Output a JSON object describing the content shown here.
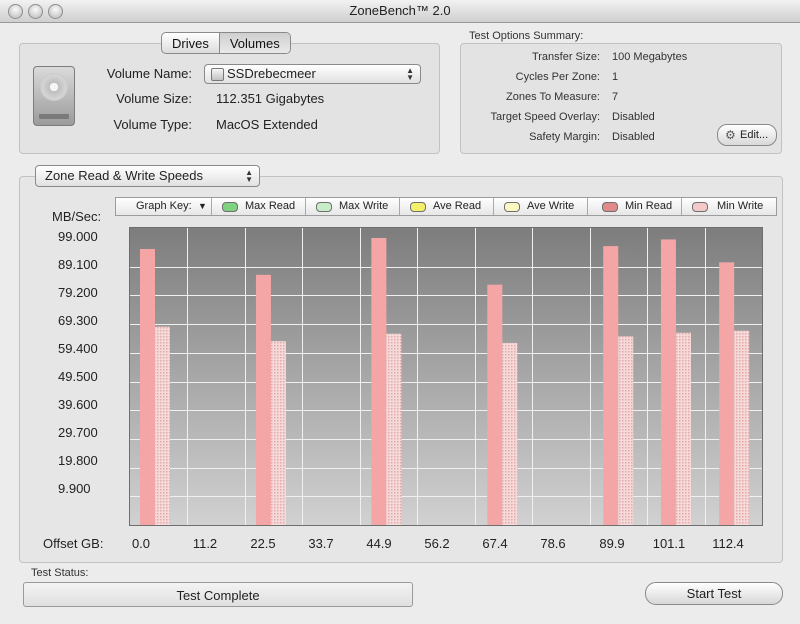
{
  "window": {
    "title": "ZoneBench™ 2.0"
  },
  "tabs": [
    {
      "label": "Drives"
    },
    {
      "label": "Volumes",
      "selected": true
    }
  ],
  "volume": {
    "name_label": "Volume Name:",
    "name_value": "SSDrebecmeer",
    "size_label": "Volume Size:",
    "size_value": "112.351 Gigabytes",
    "type_label": "Volume Type:",
    "type_value": "MacOS Extended",
    "icon": "hard-drive-icon"
  },
  "options": {
    "heading": "Test Options Summary:",
    "rows": [
      {
        "label": "Transfer Size:",
        "value": "100 Megabytes"
      },
      {
        "label": "Cycles Per Zone:",
        "value": "1"
      },
      {
        "label": "Zones To Measure:",
        "value": "7"
      },
      {
        "label": "Target Speed Overlay:",
        "value": "Disabled"
      },
      {
        "label": "Safety Margin:",
        "value": "Disabled"
      }
    ],
    "edit_label": "Edit..."
  },
  "graph": {
    "selector_value": "Zone Read & Write Speeds",
    "key_label": "Graph Key:",
    "key_items": [
      {
        "label": "Max Read",
        "color": "#7fd27f"
      },
      {
        "label": "Max Write",
        "color": "#c8ecc8"
      },
      {
        "label": "Ave Read",
        "color": "#f5f06a"
      },
      {
        "label": "Ave Write",
        "color": "#fbf8c2"
      },
      {
        "label": "Min Read",
        "color": "#e08a8a"
      },
      {
        "label": "Min Write",
        "color": "#f3c9c9"
      }
    ],
    "y_unit_label": "MB/Sec:",
    "x_unit_label": "Offset GB:"
  },
  "chart_data": {
    "type": "bar",
    "y_ticks": [
      "99.000",
      "89.100",
      "79.200",
      "69.300",
      "59.400",
      "49.500",
      "39.600",
      "29.700",
      "19.800",
      "9.900"
    ],
    "x_ticks": [
      "0.0",
      "11.2",
      "22.5",
      "33.7",
      "44.9",
      "56.2",
      "67.4",
      "78.6",
      "89.9",
      "101.1",
      "112.4"
    ],
    "ylim": [
      0,
      99
    ],
    "zones": [
      0,
      22.5,
      44.9,
      67.4,
      89.9,
      101.1,
      112.4
    ],
    "series": [
      {
        "name": "Min Read",
        "color": "#f4a6a6",
        "values": [
          95.2,
          86.3,
          99.0,
          82.9,
          96.2,
          98.5,
          90.6
        ]
      },
      {
        "name": "Min Write",
        "color": "#f3c9c9",
        "values": [
          68.4,
          63.4,
          66.0,
          62.8,
          65.1,
          66.3,
          67.0
        ]
      }
    ]
  },
  "status": {
    "label": "Test Status:",
    "value": "Test Complete"
  },
  "start_button": {
    "label": "Start Test"
  }
}
